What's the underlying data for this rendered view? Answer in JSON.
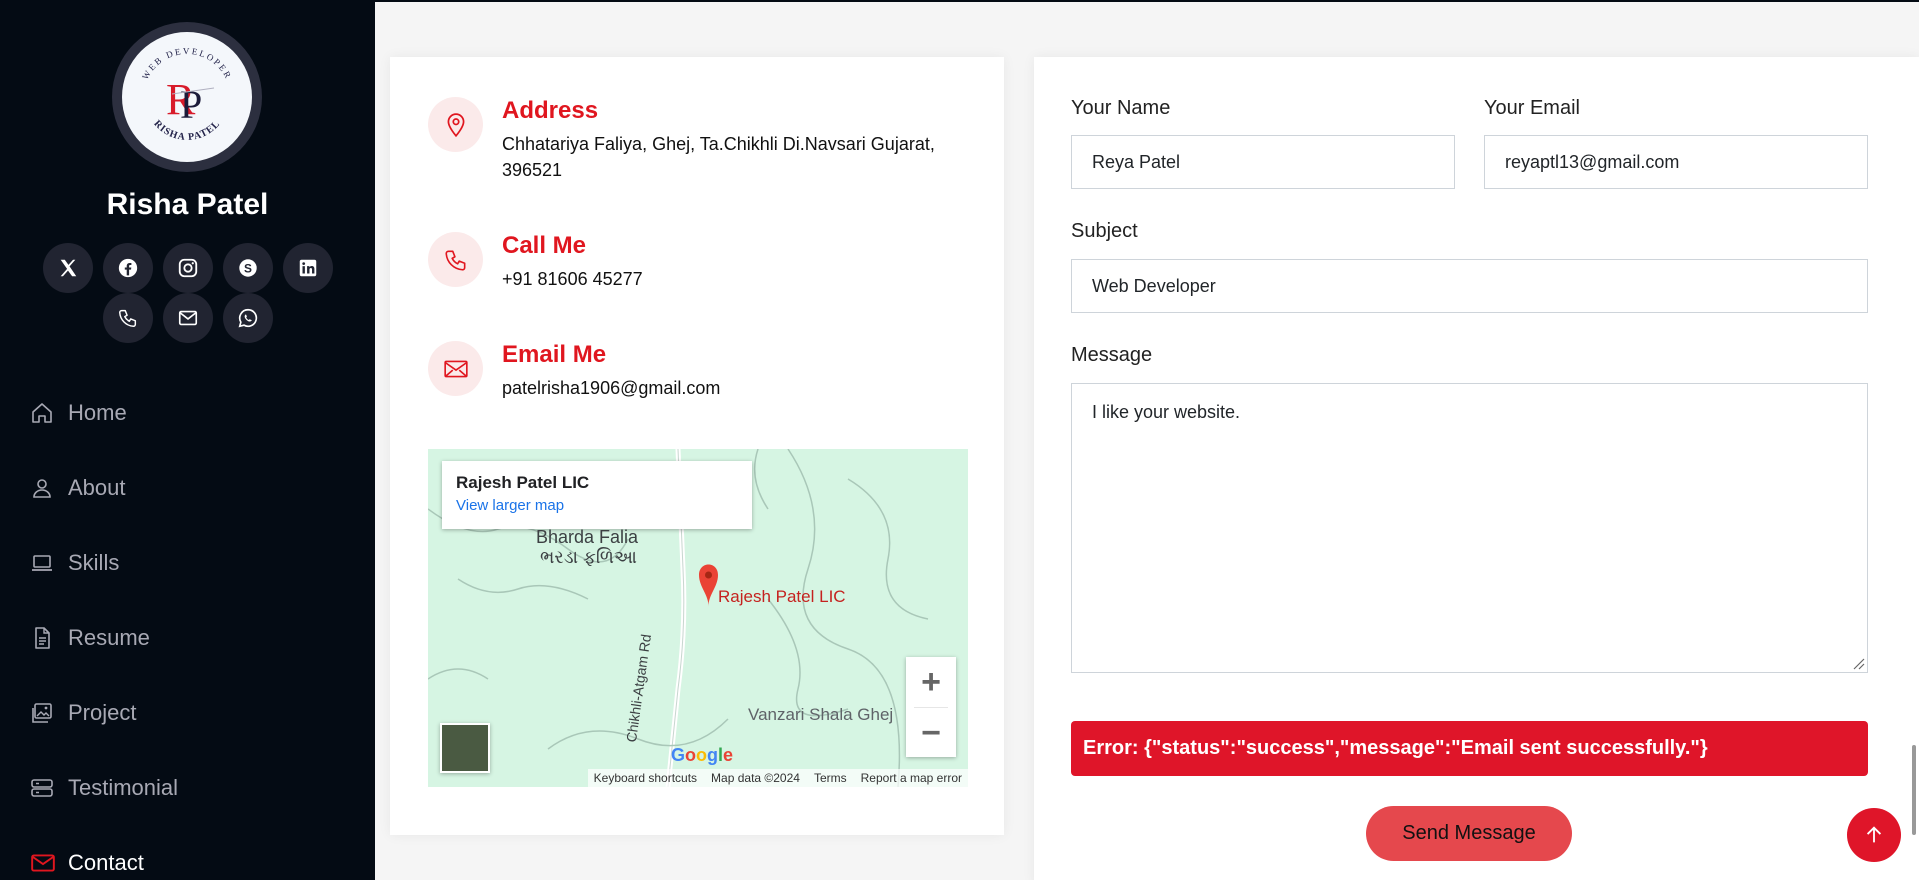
{
  "profile": {
    "name": "Risha Patel",
    "logo_top_text": "WEB DEVELOPER",
    "logo_bottom_text": "RISHA PATEL",
    "logo_monogram": "RP"
  },
  "social": [
    {
      "name": "x-twitter-icon"
    },
    {
      "name": "facebook-icon"
    },
    {
      "name": "instagram-icon"
    },
    {
      "name": "skype-icon"
    },
    {
      "name": "linkedin-icon"
    },
    {
      "name": "phone-icon"
    },
    {
      "name": "envelope-icon"
    },
    {
      "name": "whatsapp-icon"
    }
  ],
  "nav": {
    "items": [
      {
        "label": "Home",
        "icon": "house-icon"
      },
      {
        "label": "About",
        "icon": "person-icon"
      },
      {
        "label": "Skills",
        "icon": "laptop-icon"
      },
      {
        "label": "Resume",
        "icon": "file-icon"
      },
      {
        "label": "Project",
        "icon": "images-icon"
      },
      {
        "label": "Testimonial",
        "icon": "server-icon"
      },
      {
        "label": "Contact",
        "icon": "envelope-icon",
        "active": true
      }
    ]
  },
  "contact_info": {
    "address_title": "Address",
    "address_text": "Chhatariya Faliya, Ghej, Ta.Chikhli Di.Navsari Gujarat, 396521",
    "call_title": "Call Me",
    "call_text": "+91 81606 45277",
    "email_title": "Email Me",
    "email_text": "patelrisha1906@gmail.com"
  },
  "map": {
    "place_title": "Rajesh Patel LIC",
    "view_larger": "View larger map",
    "area_name": "Bharda Falia",
    "area_name_gu": "ભરડા ફળિઆ",
    "pin_label": "Rajesh Patel LIC",
    "road_label": "Chikhli-Atgam Rd",
    "school_label": "Vanzari Shala Ghej",
    "google": "Google",
    "footer": [
      "Keyboard shortcuts",
      "Map data ©2024",
      "Terms",
      "Report a map error"
    ],
    "zoom_in": "+",
    "zoom_out": "−"
  },
  "form": {
    "name_label": "Your Name",
    "name_value": "Reya Patel",
    "email_label": "Your Email",
    "email_value": "reyaptl13@gmail.com",
    "subject_label": "Subject",
    "subject_value": "Web Developer",
    "message_label": "Message",
    "message_value": "I like your website.",
    "error_text": "Error: {\"status\":\"success\",\"message\":\"Email sent successfully.\"}",
    "submit_label": "Send Message"
  },
  "colors": {
    "accent": "#e0161f",
    "sidebar_bg": "#040b14",
    "error_bg": "#df1529"
  }
}
